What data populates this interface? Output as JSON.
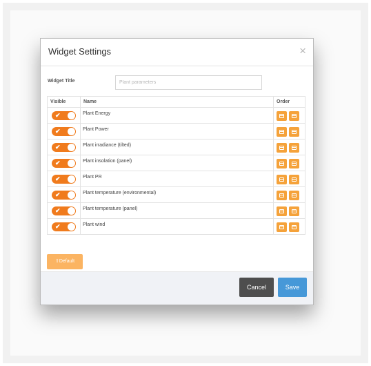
{
  "modal": {
    "title": "Widget Settings",
    "close_glyph": "×"
  },
  "form": {
    "widget_title_label": "Widget Title",
    "widget_title_placeholder": "Plant parameters",
    "widget_title_value": ""
  },
  "table": {
    "columns": {
      "visible": "Visible",
      "name": "Name",
      "order": "Order"
    },
    "rows": [
      {
        "name": "Plant Energy",
        "visible": true
      },
      {
        "name": "Plant Power",
        "visible": true
      },
      {
        "name": "Plant irradiance (tilted)",
        "visible": true
      },
      {
        "name": "Plant insolation (panel)",
        "visible": true
      },
      {
        "name": "Plant PR",
        "visible": true
      },
      {
        "name": "Plant temperature (environmental)",
        "visible": true
      },
      {
        "name": "Plant temperature (panel)",
        "visible": true
      },
      {
        "name": "Plant wind",
        "visible": true
      }
    ],
    "toggle_check": "✔"
  },
  "buttons": {
    "default_label": "Default",
    "cancel_label": "Cancel",
    "save_label": "Save"
  },
  "colors": {
    "toggle_on": "#f07b1d",
    "order_button": "#f5a23a",
    "default_button": "#fbb462",
    "cancel_button": "#4e4e4e",
    "save_button": "#4698d8"
  },
  "icons": {
    "close": "close-icon",
    "check": "check-icon",
    "move_up": "move-up-icon",
    "move_down": "move-down-icon"
  }
}
